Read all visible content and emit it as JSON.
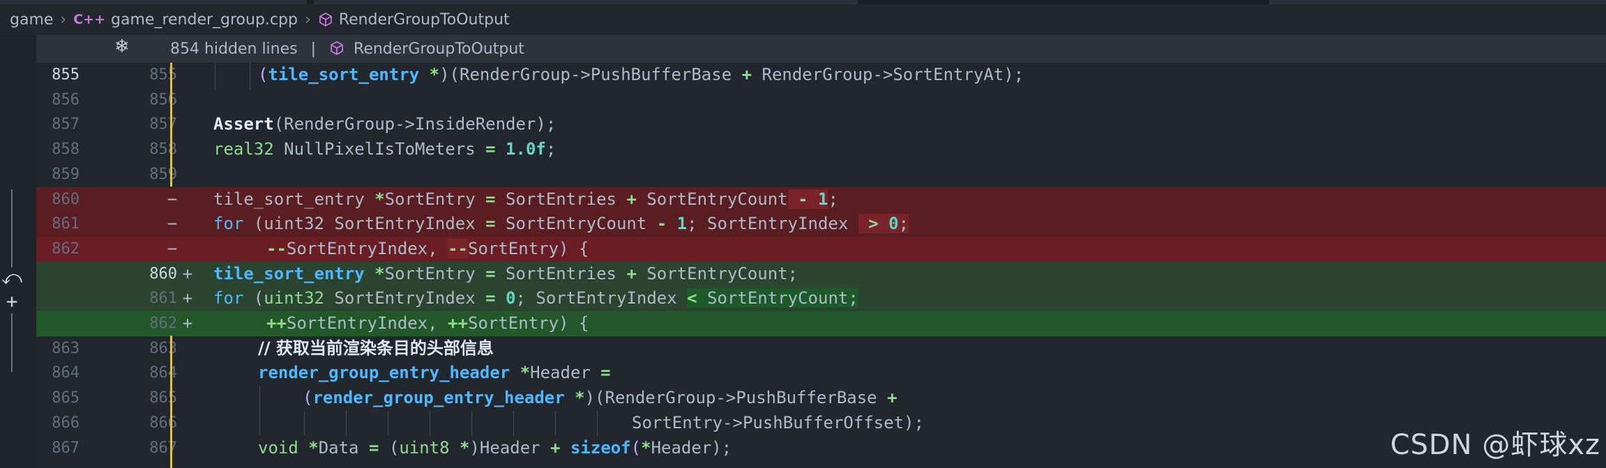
{
  "breadcrumb": {
    "folder": "game",
    "file_icon": "C++",
    "file": "game_render_group.cpp",
    "symbol": "RenderGroupToOutput"
  },
  "hidden": {
    "text": "854 hidden lines",
    "separator": "|",
    "symbol": "RenderGroupToOutput"
  },
  "lines": [
    {
      "old": "855",
      "new": "855"
    },
    {
      "old": "856",
      "new": "856"
    },
    {
      "old": "857",
      "new": "857"
    },
    {
      "old": "858",
      "new": "858"
    },
    {
      "old": "859",
      "new": "859"
    },
    {
      "old": "860",
      "new": "",
      "sign": "−"
    },
    {
      "old": "861",
      "new": "",
      "sign": "−"
    },
    {
      "old": "862",
      "new": "",
      "sign": "−"
    },
    {
      "old": "",
      "new": "860",
      "sign": "+"
    },
    {
      "old": "",
      "new": "861",
      "sign": "+"
    },
    {
      "old": "",
      "new": "862",
      "sign": "+"
    },
    {
      "old": "863",
      "new": "863"
    },
    {
      "old": "864",
      "new": "864"
    },
    {
      "old": "865",
      "new": "865"
    },
    {
      "old": "866",
      "new": "866"
    },
    {
      "old": "867",
      "new": "867"
    }
  ],
  "code": {
    "l855": [
      "(",
      "tile_sort_entry",
      " *",
      ")(RenderGroup->PushBufferBase ",
      "+",
      " RenderGroup->SortEntryAt);"
    ],
    "l857": [
      "Assert",
      "(RenderGroup->InsideRender);"
    ],
    "l858": [
      "real32",
      " NullPixelIsToMeters ",
      "=",
      " ",
      "1.0f",
      ";"
    ],
    "d860": [
      "tile_sort_entry ",
      "*",
      "SortEntry ",
      "=",
      " SortEntries ",
      "+",
      " SortEntryCount",
      " - ",
      "1",
      ";"
    ],
    "d861": [
      "for",
      " (uint32 SortEntryIndex ",
      "=",
      " SortEntryCount ",
      "-",
      " ",
      "1",
      "; SortEntryIndex ",
      " > ",
      "0",
      ";"
    ],
    "d862": [
      "--",
      "SortEntryIndex, ",
      "--",
      "SortEntry) {"
    ],
    "a860": [
      "tile_sort_entry",
      " ",
      "*",
      "SortEntry ",
      "=",
      " SortEntries ",
      "+",
      " SortEntryCount",
      ";"
    ],
    "a861": [
      "for",
      " (",
      "uint32",
      " SortEntryIndex ",
      "=",
      " ",
      "0",
      "; SortEntryIndex ",
      "<",
      " SortEntryCount;"
    ],
    "a862": [
      "++",
      "SortEntryIndex, ",
      "++",
      "SortEntry) {"
    ],
    "l863": [
      "// 获取当前渲染条目的头部信息"
    ],
    "l864": [
      "render_group_entry_header",
      " ",
      "*",
      "Header ",
      "="
    ],
    "l865": [
      "(",
      "render_group_entry_header",
      " *",
      ")(RenderGroup->PushBufferBase ",
      "+"
    ],
    "l866": [
      "SortEntry->PushBufferOffset);"
    ],
    "l867": [
      "void",
      " ",
      "*",
      "Data ",
      "=",
      " (",
      "uint8",
      " *",
      ")Header ",
      "+",
      " ",
      "sizeof",
      "(",
      "*",
      "Header);"
    ]
  },
  "watermark": "CSDN @虾球xz",
  "colors": {
    "deleted_bg": "#5a1d22",
    "added_bg": "#2a4430",
    "keyword": "#4db8ff",
    "type": "#8ddb8c",
    "number": "#5fd7c6",
    "modified_gutter": "#e6c042"
  }
}
